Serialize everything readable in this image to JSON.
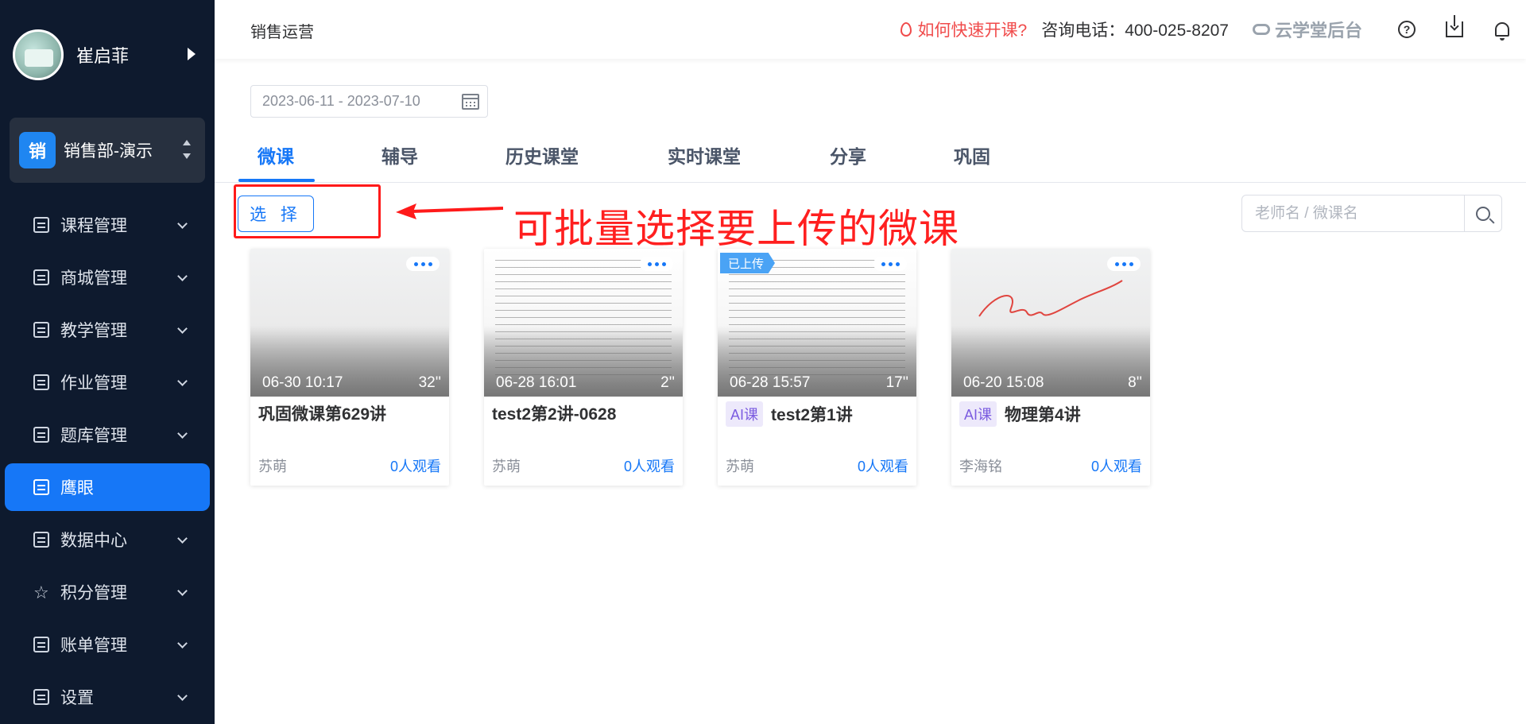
{
  "sidebar": {
    "user_name": "崔启菲",
    "org_badge": "销",
    "org_name": "销售部-演示",
    "items": [
      {
        "label": "课程管理",
        "expandable": true,
        "active": false
      },
      {
        "label": "商城管理",
        "expandable": true,
        "active": false
      },
      {
        "label": "教学管理",
        "expandable": true,
        "active": false
      },
      {
        "label": "作业管理",
        "expandable": true,
        "active": false
      },
      {
        "label": "题库管理",
        "expandable": true,
        "active": false
      },
      {
        "label": "鹰眼",
        "expandable": false,
        "active": true
      },
      {
        "label": "数据中心",
        "expandable": true,
        "active": false
      },
      {
        "label": "积分管理",
        "expandable": true,
        "active": false
      },
      {
        "label": "账单管理",
        "expandable": true,
        "active": false
      },
      {
        "label": "设置",
        "expandable": true,
        "active": false
      }
    ]
  },
  "header": {
    "breadcrumb": "销售运营",
    "fast_open": "如何快速开课?",
    "hotline": "咨询电话：400-025-8207",
    "backend_link": "云学堂后台",
    "help_icon": "?"
  },
  "filter": {
    "date_range": "2023-06-11 - 2023-07-10"
  },
  "tabs": [
    "微课",
    "辅导",
    "历史课堂",
    "实时课堂",
    "分享",
    "巩固"
  ],
  "active_tab": "微课",
  "toolbar": {
    "select_label": "选 择",
    "search_placeholder": "老师名 / 微课名"
  },
  "annotation": {
    "text": "可批量选择要上传的微课",
    "color": "#ff1f1f"
  },
  "cards": [
    {
      "date": "06-30 10:17",
      "duration": "32''",
      "title": "巩固微课第629讲",
      "ai": false,
      "ai_label": "",
      "uploaded": false,
      "uploaded_label": "",
      "teacher": "苏萌",
      "views": "0人观看",
      "thumb": "blank"
    },
    {
      "date": "06-28 16:01",
      "duration": "2''",
      "title": "test2第2讲-0628",
      "ai": false,
      "ai_label": "",
      "uploaded": false,
      "uploaded_label": "",
      "teacher": "苏萌",
      "views": "0人观看",
      "thumb": "document"
    },
    {
      "date": "06-28 15:57",
      "duration": "17''",
      "title": "test2第1讲",
      "ai": true,
      "ai_label": "AI课",
      "uploaded": true,
      "uploaded_label": "已上传",
      "teacher": "苏萌",
      "views": "0人观看",
      "thumb": "document"
    },
    {
      "date": "06-20 15:08",
      "duration": "8''",
      "title": "物理第4讲",
      "ai": true,
      "ai_label": "AI课",
      "uploaded": false,
      "uploaded_label": "",
      "teacher": "李海铭",
      "views": "0人观看",
      "thumb": "scribble"
    }
  ],
  "colors": {
    "primary": "#1677f7",
    "sidebar_bg": "#0e1a2e",
    "danger": "#f04b4b",
    "ai_tag_text": "#7b5ce0"
  }
}
